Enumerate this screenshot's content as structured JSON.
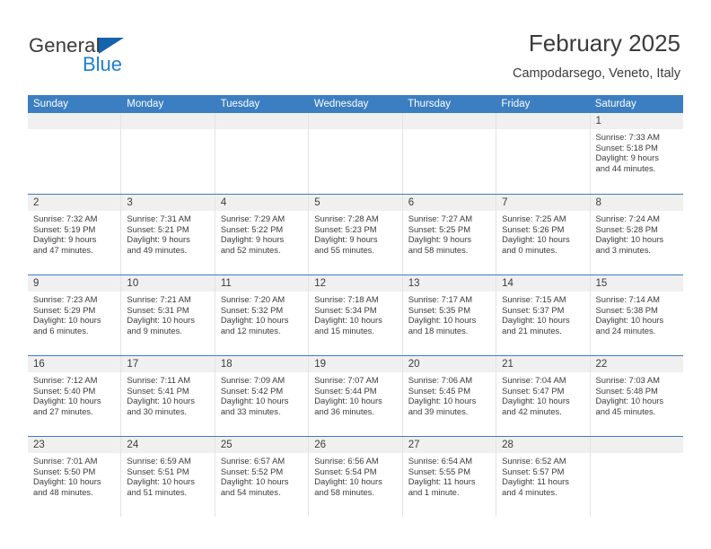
{
  "brand": {
    "name_part1": "General",
    "name_part2": "Blue",
    "triangle_icon": "blue-triangle-icon",
    "accent_color": "#1c7fd4"
  },
  "header": {
    "title": "February 2025",
    "subtitle": "Campodarsego, Veneto, Italy"
  },
  "colors": {
    "header_row_bg": "#3b7ec1",
    "header_row_text": "#ffffff",
    "day_band_bg": "#f0f0f0",
    "text": "#3b3b3b",
    "grid_line": "#e3e3e3",
    "row_divider": "#3b7ec1"
  },
  "weekday_headers": [
    "Sunday",
    "Monday",
    "Tuesday",
    "Wednesday",
    "Thursday",
    "Friday",
    "Saturday"
  ],
  "weeks": [
    [
      {
        "day": "",
        "sunrise": "",
        "sunset": "",
        "daylight_line1": "",
        "daylight_line2": ""
      },
      {
        "day": "",
        "sunrise": "",
        "sunset": "",
        "daylight_line1": "",
        "daylight_line2": ""
      },
      {
        "day": "",
        "sunrise": "",
        "sunset": "",
        "daylight_line1": "",
        "daylight_line2": ""
      },
      {
        "day": "",
        "sunrise": "",
        "sunset": "",
        "daylight_line1": "",
        "daylight_line2": ""
      },
      {
        "day": "",
        "sunrise": "",
        "sunset": "",
        "daylight_line1": "",
        "daylight_line2": ""
      },
      {
        "day": "",
        "sunrise": "",
        "sunset": "",
        "daylight_line1": "",
        "daylight_line2": ""
      },
      {
        "day": "1",
        "sunrise": "Sunrise: 7:33 AM",
        "sunset": "Sunset: 5:18 PM",
        "daylight_line1": "Daylight: 9 hours",
        "daylight_line2": "and 44 minutes."
      }
    ],
    [
      {
        "day": "2",
        "sunrise": "Sunrise: 7:32 AM",
        "sunset": "Sunset: 5:19 PM",
        "daylight_line1": "Daylight: 9 hours",
        "daylight_line2": "and 47 minutes."
      },
      {
        "day": "3",
        "sunrise": "Sunrise: 7:31 AM",
        "sunset": "Sunset: 5:21 PM",
        "daylight_line1": "Daylight: 9 hours",
        "daylight_line2": "and 49 minutes."
      },
      {
        "day": "4",
        "sunrise": "Sunrise: 7:29 AM",
        "sunset": "Sunset: 5:22 PM",
        "daylight_line1": "Daylight: 9 hours",
        "daylight_line2": "and 52 minutes."
      },
      {
        "day": "5",
        "sunrise": "Sunrise: 7:28 AM",
        "sunset": "Sunset: 5:23 PM",
        "daylight_line1": "Daylight: 9 hours",
        "daylight_line2": "and 55 minutes."
      },
      {
        "day": "6",
        "sunrise": "Sunrise: 7:27 AM",
        "sunset": "Sunset: 5:25 PM",
        "daylight_line1": "Daylight: 9 hours",
        "daylight_line2": "and 58 minutes."
      },
      {
        "day": "7",
        "sunrise": "Sunrise: 7:25 AM",
        "sunset": "Sunset: 5:26 PM",
        "daylight_line1": "Daylight: 10 hours",
        "daylight_line2": "and 0 minutes."
      },
      {
        "day": "8",
        "sunrise": "Sunrise: 7:24 AM",
        "sunset": "Sunset: 5:28 PM",
        "daylight_line1": "Daylight: 10 hours",
        "daylight_line2": "and 3 minutes."
      }
    ],
    [
      {
        "day": "9",
        "sunrise": "Sunrise: 7:23 AM",
        "sunset": "Sunset: 5:29 PM",
        "daylight_line1": "Daylight: 10 hours",
        "daylight_line2": "and 6 minutes."
      },
      {
        "day": "10",
        "sunrise": "Sunrise: 7:21 AM",
        "sunset": "Sunset: 5:31 PM",
        "daylight_line1": "Daylight: 10 hours",
        "daylight_line2": "and 9 minutes."
      },
      {
        "day": "11",
        "sunrise": "Sunrise: 7:20 AM",
        "sunset": "Sunset: 5:32 PM",
        "daylight_line1": "Daylight: 10 hours",
        "daylight_line2": "and 12 minutes."
      },
      {
        "day": "12",
        "sunrise": "Sunrise: 7:18 AM",
        "sunset": "Sunset: 5:34 PM",
        "daylight_line1": "Daylight: 10 hours",
        "daylight_line2": "and 15 minutes."
      },
      {
        "day": "13",
        "sunrise": "Sunrise: 7:17 AM",
        "sunset": "Sunset: 5:35 PM",
        "daylight_line1": "Daylight: 10 hours",
        "daylight_line2": "and 18 minutes."
      },
      {
        "day": "14",
        "sunrise": "Sunrise: 7:15 AM",
        "sunset": "Sunset: 5:37 PM",
        "daylight_line1": "Daylight: 10 hours",
        "daylight_line2": "and 21 minutes."
      },
      {
        "day": "15",
        "sunrise": "Sunrise: 7:14 AM",
        "sunset": "Sunset: 5:38 PM",
        "daylight_line1": "Daylight: 10 hours",
        "daylight_line2": "and 24 minutes."
      }
    ],
    [
      {
        "day": "16",
        "sunrise": "Sunrise: 7:12 AM",
        "sunset": "Sunset: 5:40 PM",
        "daylight_line1": "Daylight: 10 hours",
        "daylight_line2": "and 27 minutes."
      },
      {
        "day": "17",
        "sunrise": "Sunrise: 7:11 AM",
        "sunset": "Sunset: 5:41 PM",
        "daylight_line1": "Daylight: 10 hours",
        "daylight_line2": "and 30 minutes."
      },
      {
        "day": "18",
        "sunrise": "Sunrise: 7:09 AM",
        "sunset": "Sunset: 5:42 PM",
        "daylight_line1": "Daylight: 10 hours",
        "daylight_line2": "and 33 minutes."
      },
      {
        "day": "19",
        "sunrise": "Sunrise: 7:07 AM",
        "sunset": "Sunset: 5:44 PM",
        "daylight_line1": "Daylight: 10 hours",
        "daylight_line2": "and 36 minutes."
      },
      {
        "day": "20",
        "sunrise": "Sunrise: 7:06 AM",
        "sunset": "Sunset: 5:45 PM",
        "daylight_line1": "Daylight: 10 hours",
        "daylight_line2": "and 39 minutes."
      },
      {
        "day": "21",
        "sunrise": "Sunrise: 7:04 AM",
        "sunset": "Sunset: 5:47 PM",
        "daylight_line1": "Daylight: 10 hours",
        "daylight_line2": "and 42 minutes."
      },
      {
        "day": "22",
        "sunrise": "Sunrise: 7:03 AM",
        "sunset": "Sunset: 5:48 PM",
        "daylight_line1": "Daylight: 10 hours",
        "daylight_line2": "and 45 minutes."
      }
    ],
    [
      {
        "day": "23",
        "sunrise": "Sunrise: 7:01 AM",
        "sunset": "Sunset: 5:50 PM",
        "daylight_line1": "Daylight: 10 hours",
        "daylight_line2": "and 48 minutes."
      },
      {
        "day": "24",
        "sunrise": "Sunrise: 6:59 AM",
        "sunset": "Sunset: 5:51 PM",
        "daylight_line1": "Daylight: 10 hours",
        "daylight_line2": "and 51 minutes."
      },
      {
        "day": "25",
        "sunrise": "Sunrise: 6:57 AM",
        "sunset": "Sunset: 5:52 PM",
        "daylight_line1": "Daylight: 10 hours",
        "daylight_line2": "and 54 minutes."
      },
      {
        "day": "26",
        "sunrise": "Sunrise: 6:56 AM",
        "sunset": "Sunset: 5:54 PM",
        "daylight_line1": "Daylight: 10 hours",
        "daylight_line2": "and 58 minutes."
      },
      {
        "day": "27",
        "sunrise": "Sunrise: 6:54 AM",
        "sunset": "Sunset: 5:55 PM",
        "daylight_line1": "Daylight: 11 hours",
        "daylight_line2": "and 1 minute."
      },
      {
        "day": "28",
        "sunrise": "Sunrise: 6:52 AM",
        "sunset": "Sunset: 5:57 PM",
        "daylight_line1": "Daylight: 11 hours",
        "daylight_line2": "and 4 minutes."
      },
      {
        "day": "",
        "sunrise": "",
        "sunset": "",
        "daylight_line1": "",
        "daylight_line2": ""
      }
    ]
  ]
}
